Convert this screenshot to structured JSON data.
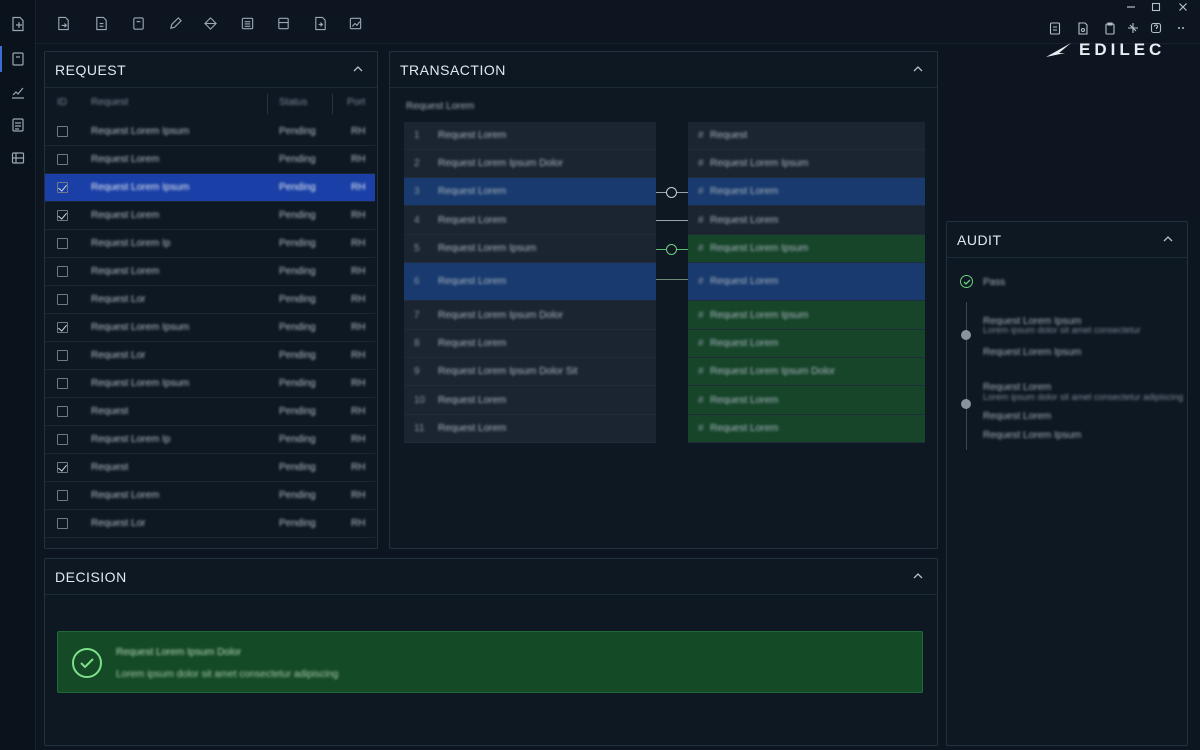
{
  "brand": {
    "logo_text": "EDILEC"
  },
  "colors": {
    "accent_blue": "#1a3fa6",
    "row_blue": "#183a6e",
    "success_green": "#154a26",
    "success_icon": "#7fe08c"
  },
  "rail": {
    "icons": [
      "document-icon",
      "file-icon",
      "chart-edit-icon",
      "list-icon",
      "grid-icon"
    ]
  },
  "toolbar": {
    "icons": [
      "file-export-icon",
      "document-icon",
      "note-icon",
      "pencil-icon",
      "diamond-icon",
      "table-icon",
      "layout-icon",
      "import-icon",
      "chart-icon"
    ],
    "right_icons": [
      "doc-icon",
      "doc-alt-icon",
      "clipboard-icon",
      "sparkle-icon",
      "help-icon",
      "more-icon"
    ]
  },
  "window_controls": [
    "minimize",
    "maximize",
    "close"
  ],
  "request": {
    "title": "REQUEST",
    "headers": [
      "ID",
      "Request",
      "Status",
      "Port"
    ],
    "rows": [
      {
        "checked": false,
        "selected": false,
        "name": "Request Lorem Ipsum",
        "status": "Pending",
        "port": "RH"
      },
      {
        "checked": false,
        "selected": false,
        "name": "Request Lorem",
        "status": "Pending",
        "port": "RH"
      },
      {
        "checked": true,
        "selected": true,
        "name": "Request Lorem Ipsum",
        "status": "Pending",
        "port": "RH"
      },
      {
        "checked": true,
        "selected": false,
        "name": "Request Lorem",
        "status": "Pending",
        "port": "RH"
      },
      {
        "checked": false,
        "selected": false,
        "name": "Request Lorem Ip",
        "status": "Pending",
        "port": "RH"
      },
      {
        "checked": false,
        "selected": false,
        "name": "Request Lorem",
        "status": "Pending",
        "port": "RH"
      },
      {
        "checked": false,
        "selected": false,
        "name": "Request Lor",
        "status": "Pending",
        "port": "RH"
      },
      {
        "checked": true,
        "selected": false,
        "name": "Request Lorem Ipsum",
        "status": "Pending",
        "port": "RH"
      },
      {
        "checked": false,
        "selected": false,
        "name": "Request Lor",
        "status": "Pending",
        "port": "RH"
      },
      {
        "checked": false,
        "selected": false,
        "name": "Request Lorem Ipsum",
        "status": "Pending",
        "port": "RH"
      },
      {
        "checked": false,
        "selected": false,
        "name": "Request",
        "status": "Pending",
        "port": "RH"
      },
      {
        "checked": false,
        "selected": false,
        "name": "Request Lorem Ip",
        "status": "Pending",
        "port": "RH"
      },
      {
        "checked": true,
        "selected": false,
        "name": "Request",
        "status": "Pending",
        "port": "RH"
      },
      {
        "checked": false,
        "selected": false,
        "name": "Request Lorem",
        "status": "Pending",
        "port": "RH"
      },
      {
        "checked": false,
        "selected": false,
        "name": "Request Lor",
        "status": "Pending",
        "port": "RH"
      }
    ]
  },
  "transaction": {
    "title": "TRANSACTION",
    "subtitle": "Request Lorem",
    "left": [
      {
        "num": "1",
        "text": "Request Lorem",
        "style": ""
      },
      {
        "num": "2",
        "text": "Request Lorem Ipsum Dolor",
        "style": ""
      },
      {
        "num": "3",
        "text": "Request Lorem",
        "style": "blue"
      },
      {
        "num": "4",
        "text": "Request Lorem",
        "style": ""
      },
      {
        "num": "5",
        "text": "Request Lorem Ipsum",
        "style": ""
      },
      {
        "num": "6",
        "text": "Request Lorem",
        "style": "blue"
      },
      {
        "num": "7",
        "text": "Request Lorem Ipsum Dolor",
        "style": ""
      },
      {
        "num": "8",
        "text": "Request Lorem",
        "style": ""
      },
      {
        "num": "9",
        "text": "Request Lorem Ipsum Dolor Sit",
        "style": ""
      },
      {
        "num": "10",
        "text": "Request Lorem",
        "style": ""
      },
      {
        "num": "11",
        "text": "Request Lorem",
        "style": ""
      }
    ],
    "right": [
      {
        "num": "#",
        "text": "Request",
        "style": ""
      },
      {
        "num": "#",
        "text": "Request Lorem Ipsum",
        "style": ""
      },
      {
        "num": "#",
        "text": "Request Lorem",
        "style": "blue"
      },
      {
        "num": "#",
        "text": "Request Lorem",
        "style": ""
      },
      {
        "num": "#",
        "text": "Request Lorem Ipsum",
        "style": "green"
      },
      {
        "num": "#",
        "text": "Request Lorem",
        "style": "blue"
      },
      {
        "num": "#",
        "text": "Request Lorem Ipsum",
        "style": "green"
      },
      {
        "num": "#",
        "text": "Request Lorem",
        "style": "green"
      },
      {
        "num": "#",
        "text": "Request Lorem Ipsum Dolor",
        "style": "green"
      },
      {
        "num": "#",
        "text": "Request Lorem",
        "style": "green"
      },
      {
        "num": "#",
        "text": "Request Lorem",
        "style": "green"
      }
    ]
  },
  "audit": {
    "title": "AUDIT",
    "status_label": "Pass",
    "entries": [
      {
        "title": "Request Lorem Ipsum",
        "detail": "Lorem ipsum dolor sit amet consectetur",
        "meta": "Request Lorem Ipsum"
      },
      {
        "title": "Request Lorem",
        "detail": "Lorem ipsum dolor sit amet consectetur adipiscing",
        "meta": "Request Lorem",
        "meta2": "Request Lorem Ipsum"
      }
    ]
  },
  "decision": {
    "title": "DECISION",
    "line1": "Request Lorem Ipsum Dolor",
    "line2": "Lorem ipsum dolor sit amet consectetur adipiscing"
  }
}
